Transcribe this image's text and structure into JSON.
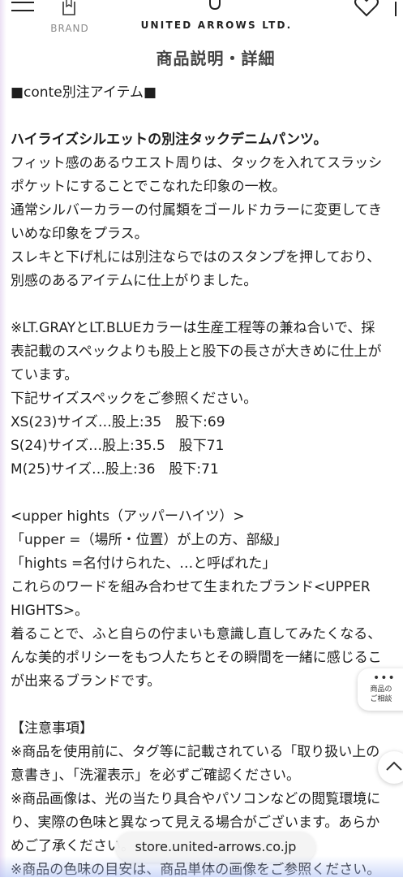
{
  "header": {
    "brand_label": "BRAND",
    "logo_text": "UNITED ARROWS LTD."
  },
  "section_title": "商品説明・詳細",
  "content": {
    "tag_line": "■conte別注アイテム■",
    "lines_block1": [
      "ハイライズシルエットの別注タックデニムパンツ。",
      "フィット感のあるウエスト周りは、タックを入れてスラッシ",
      "ポケットにすることでこなれた印象の一枚。",
      "通常シルバーカラーの付属類をゴールドカラーに変更してき",
      "いめな印象をプラス。",
      "スレキと下げ札には別注ならではのスタンプを押しており、",
      "別感のあるアイテムに仕上がりました。"
    ],
    "lines_block2": [
      "※LT.GRAYとLT.BLUEカラーは生産工程等の兼ね合いで、採",
      "表記載のスペックよりも股上と股下の長さが大きめに仕上が",
      "ています。",
      "下記サイズスペックをご参照ください。",
      "XS(23)サイズ…股上:35　股下:69",
      "S(24)サイズ…股上:35.5　股下71",
      "M(25)サイズ…股上:36　股下:71"
    ],
    "lines_block3": [
      "<upper hights（アッパーハイツ）>",
      "「upper =（場所・位置）が上の方、部級」",
      "「hights =名付けられた、…と呼ばれた」",
      "これらのワードを組み合わせて生まれたブランド<UPPER",
      "HIGHTS>。",
      "着ることで、ふと自らの佇まいも意識し直してみたくなる、",
      "んな美的ポリシーをもつ人たちとその瞬間を一緒に感じるこ",
      "が出来るブランドです。"
    ],
    "lines_block4": [
      "【注意事項】",
      "※商品を使用前に、タグ等に記載されている「取り扱い上の",
      "意書き」、「洗濯表示」を必ずご確認ください。",
      "※商品画像は、光の当たり具合やパソコンなどの閲覧環境に",
      "り、実際の色味と異なって見える場合がございます。あらか",
      "めご了承ください。",
      "※商品の色味の目安は、商品単体の画像をご参照ください。"
    ]
  },
  "floating": {
    "consult_label_1": "商品の",
    "consult_label_2": "ご相談",
    "consult_dots": "•••"
  },
  "url_bar": {
    "url": "store.united-arrows.co.jp"
  }
}
